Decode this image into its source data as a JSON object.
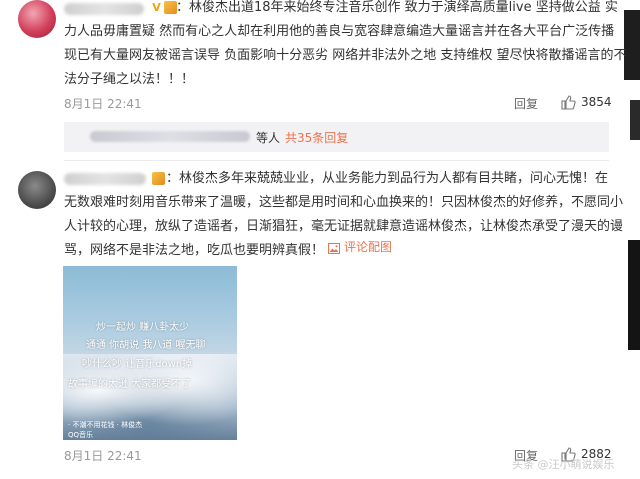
{
  "comment1": {
    "text_lines": [
      "：林俊杰出道18年来始终专注音乐创作 致力于演绎高质量live 坚持做公益 实",
      "力人品毋庸置疑 然而有心之人却在利用他的善良与宽容肆意编造大量谣言并在各大平台广泛传播",
      "现已有大量网友被谣言误导 负面影响十分恶劣 网络并非法外之地 支持维权 望尽快将散播谣言的不",
      "法分子绳之以法！！！"
    ],
    "time": "8月1日 22:41",
    "reply_label": "回复",
    "likes": "3854"
  },
  "subreplies": {
    "others": "等人",
    "total": "共35条回复"
  },
  "comment2": {
    "text_lines": [
      "：林俊杰多年来兢兢业业，从业务能力到品行为人都有目共睹，问心无愧！在",
      "无数艰难时刻用音乐带来了温暖，这些都是用时间和心血换来的！只因林俊杰的好修养，不愿同小",
      "人计较的心理，放纵了造谣者，日渐猖狂，毫无证据就肆意造谣林俊杰，让林俊杰承受了漫天的谩",
      "骂，网络不是非法之地，吃瓜也要明辨真假！"
    ],
    "pic_label": "评论配图",
    "photo": {
      "line1": "炒一起炒 赚八卦太少",
      "line2": "通通 你胡说 我八道 喔无聊",
      "line3": "吵什么吵 让音乐down掉",
      "line4": "故事编的太逊 大家都受不了",
      "credit": "· 不潮不用花钱 · 林俊杰",
      "app": "QQ音乐"
    },
    "time": "8月1日 22:41",
    "reply_label": "回复",
    "likes": "2882"
  },
  "watermark": "头条 @汪小萌说娱乐",
  "colors": {
    "link": "#eb7350",
    "text": "#333333",
    "meta": "#999999",
    "subbox_bg": "#f2f2f5"
  }
}
